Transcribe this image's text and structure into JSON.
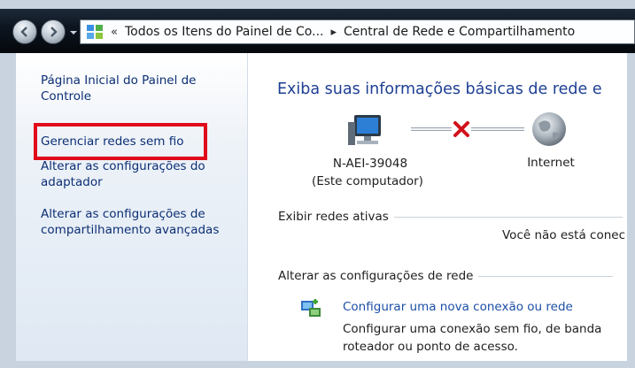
{
  "address_bar": {
    "overflow_chevron": "«",
    "crumb_1": "Todos os Itens do Painel de Co...",
    "separator": "▸",
    "crumb_2": "Central de Rede e Compartilhamento"
  },
  "nav": {
    "home": "Página Inicial do Painel de Controle",
    "manage_wireless": "Gerenciar redes sem fio",
    "adapter_settings": "Alterar as configurações do adaptador",
    "advanced_sharing": "Alterar as configurações de compartilhamento avançadas"
  },
  "main": {
    "title": "Exiba suas informações básicas de rede e",
    "computer_name": "N-AEI-39048",
    "computer_sub": "(Este computador)",
    "internet_label": "Internet",
    "active_networks_heading": "Exibir redes ativas",
    "not_connected": "Você não está conec",
    "change_settings_heading": "Alterar as configurações de rede",
    "new_connection_link": "Configurar uma nova conexão ou rede",
    "new_connection_desc": "Configurar uma conexão sem fio, de banda roteador ou ponto de acesso."
  },
  "colors": {
    "highlight": "#e00a1a",
    "link": "#0b2f74",
    "title": "#1e3f93"
  },
  "icons": {
    "back": "back-arrow-icon",
    "forward": "forward-arrow-icon",
    "control_panel": "control-panel-icon",
    "computer": "computer-icon",
    "disconnected": "red-x-icon",
    "internet": "globe-icon",
    "new_connection": "network-setup-icon"
  }
}
